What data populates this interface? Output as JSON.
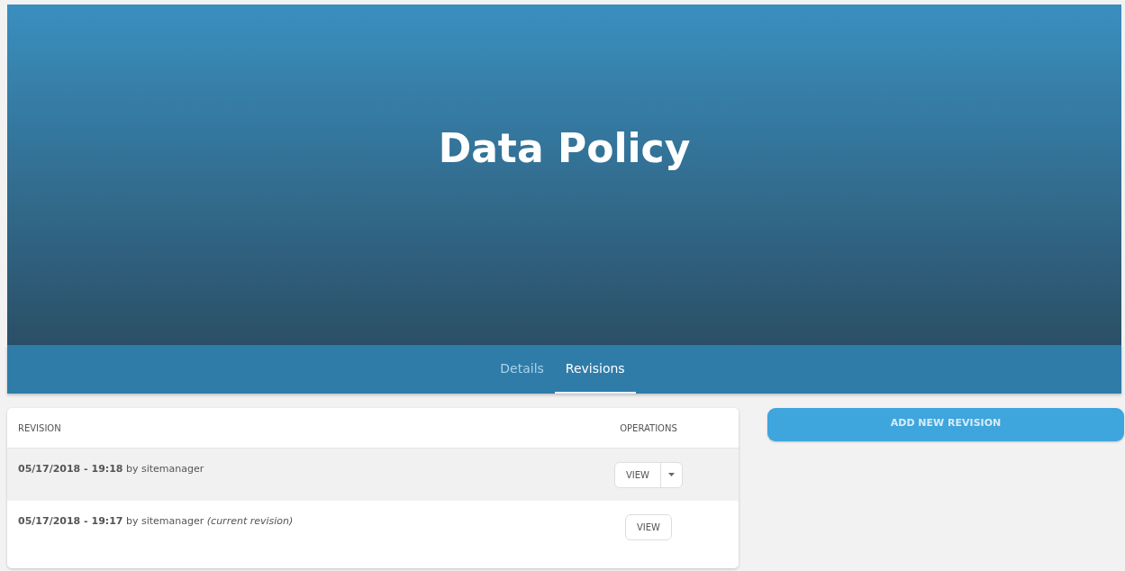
{
  "header": {
    "title": "Data Policy"
  },
  "tabs": [
    {
      "label": "Details",
      "selected": false
    },
    {
      "label": "Revisions",
      "selected": true
    }
  ],
  "table": {
    "columns": [
      "REVISION",
      "OPERATIONS"
    ],
    "rows": [
      {
        "text": "**05/17/2018 - 19:18** by sitemanager",
        "button": "VIEW",
        "has_menu": true,
        "highlighted": true
      },
      {
        "text": "**05/17/2018 - 19:17** by sitemanager *(current revision)*",
        "button": "VIEW",
        "has_menu": false,
        "highlighted": false
      }
    ]
  },
  "add_button": "ADD NEW REVISION"
}
